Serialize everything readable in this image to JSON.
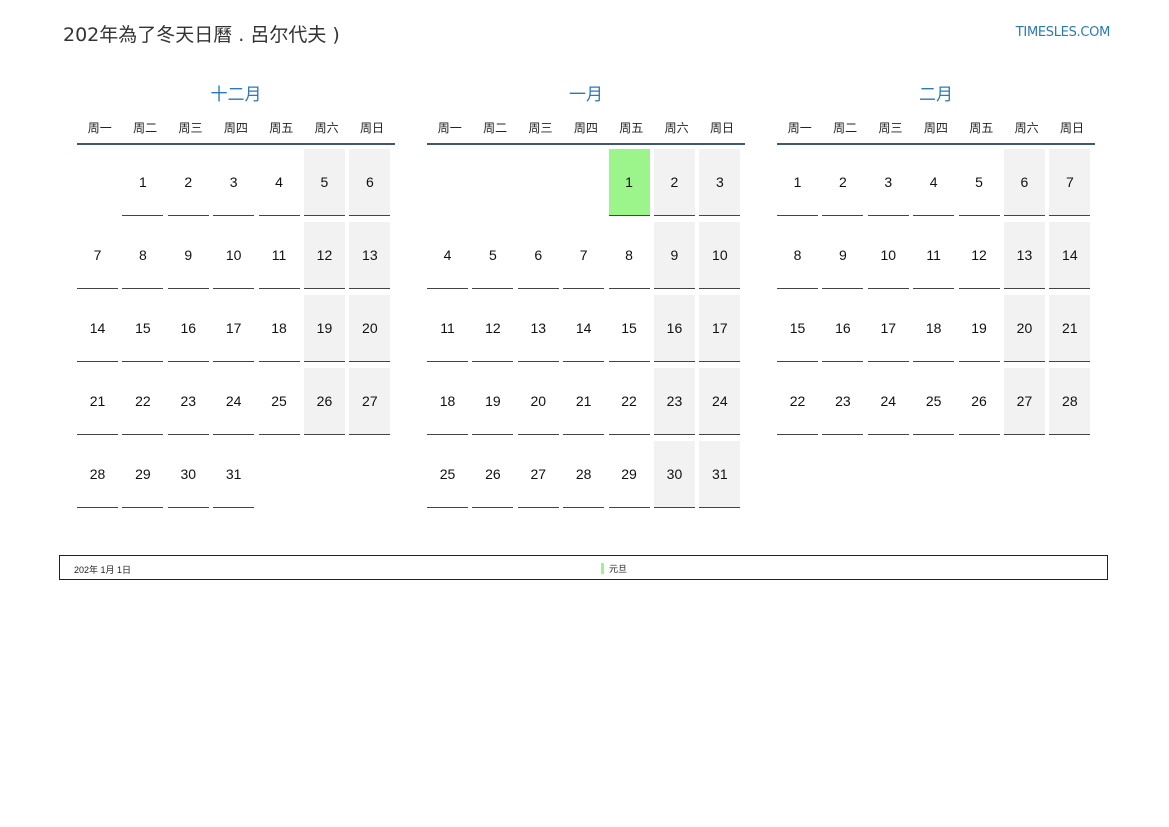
{
  "header": {
    "title": "202年為了冬天日曆 . 呂尔代夫 )",
    "site": "TIMESLES.COM"
  },
  "weekdays": [
    "周一",
    "周二",
    "周三",
    "周四",
    "周五",
    "周六",
    "周日"
  ],
  "months": [
    {
      "name": "十二月",
      "offset": 1,
      "days": [
        "1",
        "2",
        "3",
        "4",
        "5",
        "6",
        "7",
        "8",
        "9",
        "10",
        "11",
        "12",
        "13",
        "14",
        "15",
        "16",
        "17",
        "18",
        "19",
        "20",
        "21",
        "22",
        "23",
        "24",
        "25",
        "26",
        "27",
        "28",
        "29",
        "30",
        "31"
      ],
      "holidays": []
    },
    {
      "name": "一月",
      "offset": 4,
      "days": [
        "1",
        "2",
        "3",
        "4",
        "5",
        "6",
        "7",
        "8",
        "9",
        "10",
        "11",
        "12",
        "13",
        "14",
        "15",
        "16",
        "17",
        "18",
        "19",
        "20",
        "21",
        "22",
        "23",
        "24",
        "25",
        "26",
        "27",
        "28",
        "29",
        "30",
        "31"
      ],
      "holidays": [
        "1"
      ]
    },
    {
      "name": "二月",
      "offset": 0,
      "days": [
        "1",
        "2",
        "3",
        "4",
        "5",
        "6",
        "7",
        "8",
        "9",
        "10",
        "11",
        "12",
        "13",
        "14",
        "15",
        "16",
        "17",
        "18",
        "19",
        "20",
        "21",
        "22",
        "23",
        "24",
        "25",
        "26",
        "27",
        "28"
      ],
      "holidays": []
    }
  ],
  "legend": {
    "date": "202年 1月 1日",
    "holiday": "元旦"
  },
  "colors": {
    "accent": "#2a7ab8",
    "holiday": "#9cf58a",
    "weekend": "#f2f2f2"
  }
}
